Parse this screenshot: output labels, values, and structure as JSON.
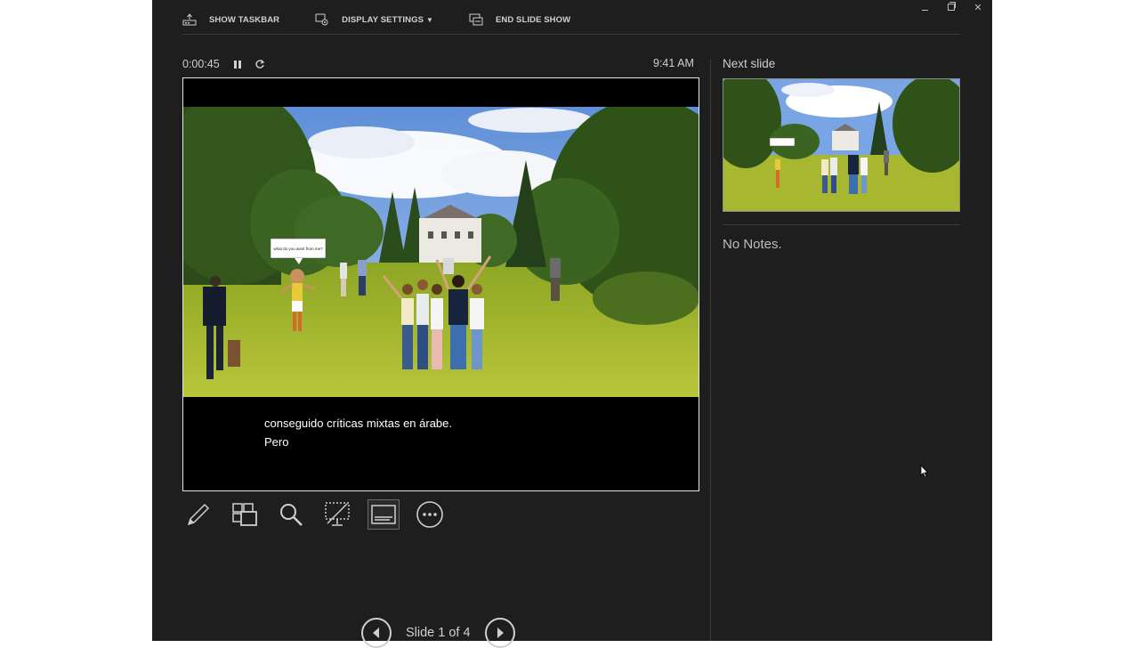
{
  "toolbar": {
    "show_taskbar": "SHOW TASKBAR",
    "display_settings": "DISPLAY SETTINGS",
    "display_settings_caret": "▼",
    "end_slide_show": "END SLIDE SHOW"
  },
  "timer": {
    "elapsed": "0:00:45",
    "clock": "9:41 AM"
  },
  "slide": {
    "speech_bubble": "what do you want from me?",
    "caption_line1": "conseguido críticas mixtas en árabe.",
    "caption_line2": "Pero"
  },
  "tools": [
    "pen-tool",
    "see-all-slides",
    "zoom-into-slide",
    "black-or-unblack-slideshow",
    "toggle-subtitles",
    "more-options"
  ],
  "navigation": {
    "label": "Slide 1 of 4",
    "current": 1,
    "total": 4
  },
  "next_slide": {
    "title": "Next slide"
  },
  "notes": {
    "text": "No Notes."
  },
  "colors": {
    "background": "#1e1e1e",
    "text": "#d9d9d9",
    "page": "#ffffff"
  }
}
